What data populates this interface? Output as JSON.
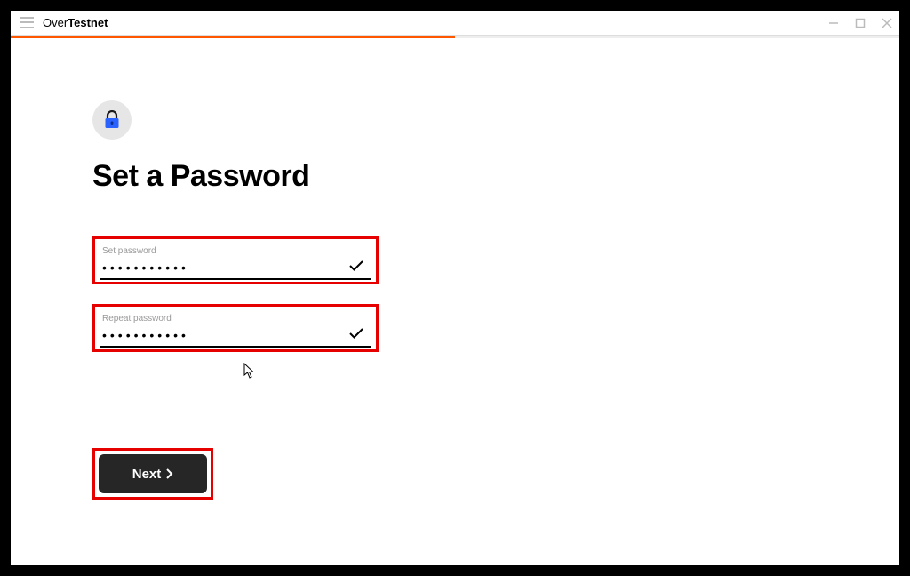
{
  "window": {
    "title_prefix": "Over",
    "title_bold": "Testnet"
  },
  "progress": {
    "percent": 50
  },
  "page": {
    "heading": "Set a Password"
  },
  "fields": {
    "password": {
      "label": "Set password",
      "value": "•••••••••••"
    },
    "repeat": {
      "label": "Repeat password",
      "value": "•••••••••••"
    }
  },
  "actions": {
    "next_label": "Next"
  },
  "colors": {
    "accent": "#ff5600",
    "highlight_box": "#e60000",
    "button_bg": "#262626"
  }
}
